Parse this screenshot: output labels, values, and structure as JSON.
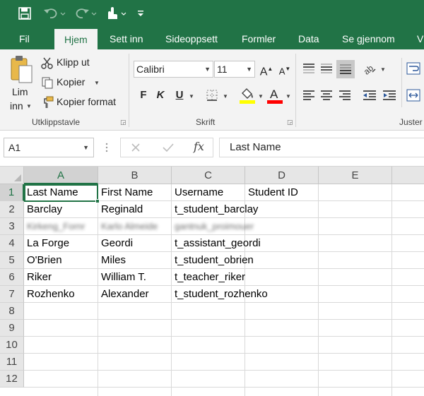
{
  "ribbon_tabs": [
    "Fil",
    "Hjem",
    "Sett inn",
    "Sideoppsett",
    "Formler",
    "Data",
    "Se gjennom",
    "V"
  ],
  "clipboard": {
    "paste_line1": "Lim",
    "paste_line2": "inn",
    "cut": "Klipp ut",
    "copy": "Kopier",
    "format_painter": "Kopier format",
    "group": "Utklippstavle"
  },
  "font": {
    "name": "Calibri",
    "size": "11",
    "bold": "F",
    "italic": "K",
    "underline": "U",
    "group": "Skrift",
    "fill_color": "#ffff00",
    "text_color": "#ff0000"
  },
  "alignment": {
    "group": "Juster"
  },
  "formula_bar": {
    "name_box": "A1",
    "fx": "fx",
    "formula": "Last Name"
  },
  "grid": {
    "columns": [
      "A",
      "B",
      "C",
      "D",
      "E"
    ],
    "rows": [
      "1",
      "2",
      "3",
      "4",
      "5",
      "6",
      "7",
      "8",
      "9",
      "10",
      "11",
      "12"
    ],
    "data": [
      [
        "Last Name",
        "First Name",
        "Username",
        "Student ID"
      ],
      [
        "Barclay",
        "Reginald",
        "t_student_barclay",
        ""
      ],
      [
        "Kirkeng_Fornr",
        "Karlo Almeide",
        "gantnuk_proimouer",
        ""
      ],
      [
        "La Forge",
        "Geordi",
        "t_assistant_geordi",
        ""
      ],
      [
        "O'Brien",
        "Miles",
        "t_student_obrien",
        ""
      ],
      [
        "Riker",
        "William T.",
        "t_teacher_riker",
        ""
      ],
      [
        "Rozhenko",
        "Alexander",
        "t_student_rozhenko",
        ""
      ]
    ]
  },
  "colors": {
    "brand": "#217346",
    "header_bg": "#e6e6e6"
  }
}
